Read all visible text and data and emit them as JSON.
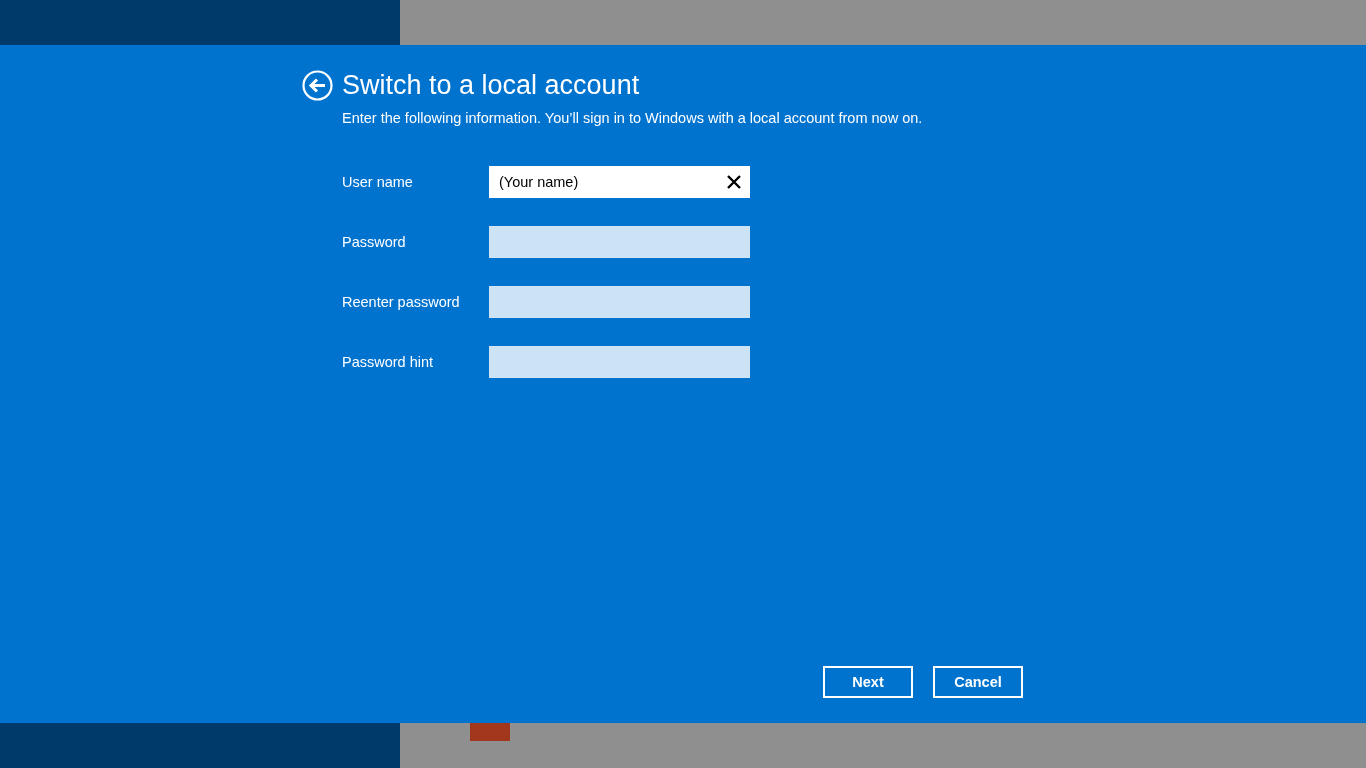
{
  "dialog": {
    "title": "Switch to a local account",
    "description": "Enter the following information. You’ll sign in to Windows with a local account from now on."
  },
  "fields": [
    {
      "label": "User name",
      "value": "(Your name)",
      "focused": true
    },
    {
      "label": "Password",
      "focused": false
    },
    {
      "label": "Reenter password",
      "focused": false
    },
    {
      "label": "Password hint",
      "focused": false
    }
  ],
  "buttons": [
    "Next",
    "Cancel"
  ]
}
